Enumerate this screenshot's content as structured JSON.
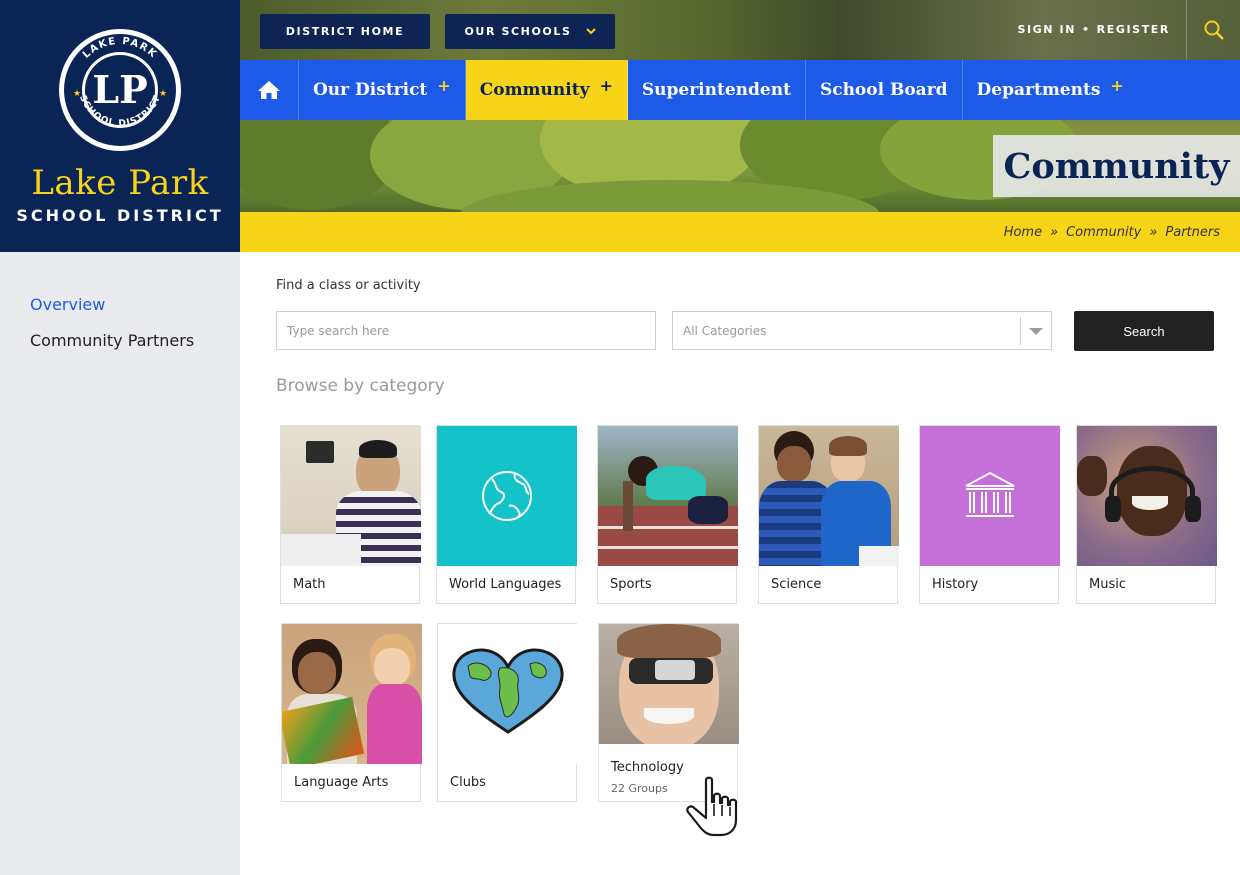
{
  "logo": {
    "seal_text": "LAKE PARK SCHOOL DISTRICT",
    "monogram": "LP",
    "name": "Lake Park",
    "subtitle": "SCHOOL DISTRICT"
  },
  "top_bar": {
    "district_home": "DISTRICT HOME",
    "our_schools": "OUR SCHOOLS",
    "sign_in": "SIGN IN",
    "separator": "•",
    "register": "REGISTER"
  },
  "nav": {
    "items": [
      {
        "label": "Our District",
        "has_submenu": true
      },
      {
        "label": "Community",
        "has_submenu": true,
        "active": true
      },
      {
        "label": "Superintendent",
        "has_submenu": false
      },
      {
        "label": "School Board",
        "has_submenu": false
      },
      {
        "label": "Departments",
        "has_submenu": true
      }
    ],
    "plus": "+"
  },
  "hero": {
    "title": "Community"
  },
  "breadcrumb": {
    "items": [
      "Home",
      "Community",
      "Partners"
    ],
    "separator": "»"
  },
  "sidebar": {
    "items": [
      {
        "label": "Overview",
        "active": true
      },
      {
        "label": "Community Partners",
        "active": false
      }
    ]
  },
  "search": {
    "label": "Find a class or activity",
    "input_placeholder": "Type search here",
    "input_value": "",
    "category_selected": "All Categories",
    "button": "Search"
  },
  "browse": {
    "title": "Browse by category",
    "categories": [
      {
        "label": "Math"
      },
      {
        "label": "World Languages"
      },
      {
        "label": "Sports"
      },
      {
        "label": "Science"
      },
      {
        "label": "History"
      },
      {
        "label": "Music"
      },
      {
        "label": "Language Arts"
      },
      {
        "label": "Clubs"
      },
      {
        "label": "Technology",
        "subtitle": "22 Groups"
      }
    ]
  },
  "colors": {
    "navy": "#0b2456",
    "brand_yellow": "#f7d417",
    "nav_blue": "#1e5ae8",
    "sidebar_bg": "#e9ebee",
    "world_languages_tile": "#14c3c9",
    "history_tile": "#c56fd8",
    "button_dark": "#222222"
  },
  "icons": {
    "home": "home-icon",
    "search": "search-icon",
    "dropdown": "chevron-down-icon",
    "world_languages": "globe-icon",
    "history": "columns-building-icon",
    "clubs": "heart-earth-icon",
    "cursor": "hand-pointer-cursor"
  }
}
